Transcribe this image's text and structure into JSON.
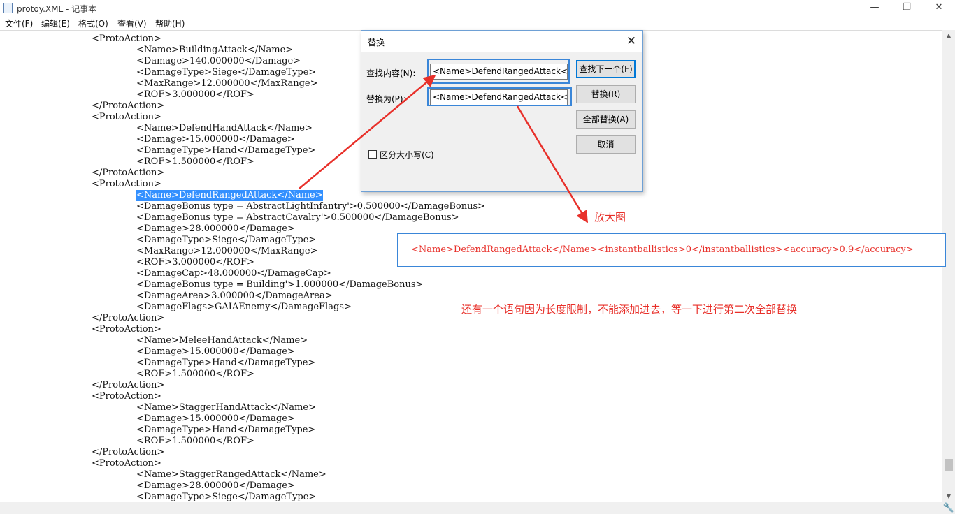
{
  "window": {
    "title": "protoy.XML - 记事本",
    "min_glyph": "—",
    "max_glyph": "❐",
    "close_glyph": "✕"
  },
  "menu": [
    "文件(F)",
    "编辑(E)",
    "格式(O)",
    "查看(V)",
    "帮助(H)"
  ],
  "code_lines": [
    {
      "text": "<ProtoAction>",
      "indent": 1
    },
    {
      "text": "<Name>BuildingAttack</Name>",
      "indent": 2
    },
    {
      "text": "<Damage>140.000000</Damage>",
      "indent": 2
    },
    {
      "text": "<DamageType>Siege</DamageType>",
      "indent": 2
    },
    {
      "text": "<MaxRange>12.000000</MaxRange>",
      "indent": 2
    },
    {
      "text": "<ROF>3.000000</ROF>",
      "indent": 2
    },
    {
      "text": "</ProtoAction>",
      "indent": 1
    },
    {
      "text": "<ProtoAction>",
      "indent": 1
    },
    {
      "text": "<Name>DefendHandAttack</Name>",
      "indent": 2
    },
    {
      "text": "<Damage>15.000000</Damage>",
      "indent": 2
    },
    {
      "text": "<DamageType>Hand</DamageType>",
      "indent": 2
    },
    {
      "text": "<ROF>1.500000</ROF>",
      "indent": 2
    },
    {
      "text": "</ProtoAction>",
      "indent": 1
    },
    {
      "text": "<ProtoAction>",
      "indent": 1
    },
    {
      "text": "<Name>DefendRangedAttack</Name>",
      "indent": 2,
      "selected": true
    },
    {
      "text": "<DamageBonus type ='AbstractLightInfantry'>0.500000</DamageBonus>",
      "indent": 2
    },
    {
      "text": "<DamageBonus type ='AbstractCavalry'>0.500000</DamageBonus>",
      "indent": 2
    },
    {
      "text": "<Damage>28.000000</Damage>",
      "indent": 2
    },
    {
      "text": "<DamageType>Siege</DamageType>",
      "indent": 2
    },
    {
      "text": "<MaxRange>12.000000</MaxRange>",
      "indent": 2
    },
    {
      "text": "<ROF>3.000000</ROF>",
      "indent": 2
    },
    {
      "text": "<DamageCap>48.000000</DamageCap>",
      "indent": 2
    },
    {
      "text": "<DamageBonus type ='Building'>1.000000</DamageBonus>",
      "indent": 2
    },
    {
      "text": "<DamageArea>3.000000</DamageArea>",
      "indent": 2
    },
    {
      "text": "<DamageFlags>GAIAEnemy</DamageFlags>",
      "indent": 2
    },
    {
      "text": "</ProtoAction>",
      "indent": 1
    },
    {
      "text": "<ProtoAction>",
      "indent": 1
    },
    {
      "text": "<Name>MeleeHandAttack</Name>",
      "indent": 2
    },
    {
      "text": "<Damage>15.000000</Damage>",
      "indent": 2
    },
    {
      "text": "<DamageType>Hand</DamageType>",
      "indent": 2
    },
    {
      "text": "<ROF>1.500000</ROF>",
      "indent": 2
    },
    {
      "text": "</ProtoAction>",
      "indent": 1
    },
    {
      "text": "<ProtoAction>",
      "indent": 1
    },
    {
      "text": "<Name>StaggerHandAttack</Name>",
      "indent": 2
    },
    {
      "text": "<Damage>15.000000</Damage>",
      "indent": 2
    },
    {
      "text": "<DamageType>Hand</DamageType>",
      "indent": 2
    },
    {
      "text": "<ROF>1.500000</ROF>",
      "indent": 2
    },
    {
      "text": "</ProtoAction>",
      "indent": 1
    },
    {
      "text": "<ProtoAction>",
      "indent": 1
    },
    {
      "text": "<Name>StaggerRangedAttack</Name>",
      "indent": 2
    },
    {
      "text": "<Damage>28.000000</Damage>",
      "indent": 2
    },
    {
      "text": "<DamageType>Siege</DamageType>",
      "indent": 2
    }
  ],
  "dialog": {
    "title": "替换",
    "close_glyph": "✕",
    "find_label": "查找内容(N):",
    "find_value": "<Name>DefendRangedAttack</I",
    "replace_label": "替换为(P):",
    "replace_value": "<Name>DefendRangedAttack</I",
    "find_next_button": "查找下一个(F)",
    "replace_button": "替换(R)",
    "replace_all_button": "全部替换(A)",
    "cancel_button": "取消",
    "match_case_label": "区分大小写(C)"
  },
  "annotations": {
    "zoom_label": "放大图",
    "zoom_text": "<Name>DefendRangedAttack</Name><instantballistics>0</instantballistics><accuracy>0.9</accuracy>",
    "note": "还有一个语句因为长度限制，不能添加进去，等一下进行第二次全部替换",
    "color": "#e8302a",
    "highlight_color": "#3a86d8"
  },
  "scrollbar": {
    "up_glyph": "▲",
    "down_glyph": "▼"
  },
  "corner_glyph": "🔧"
}
